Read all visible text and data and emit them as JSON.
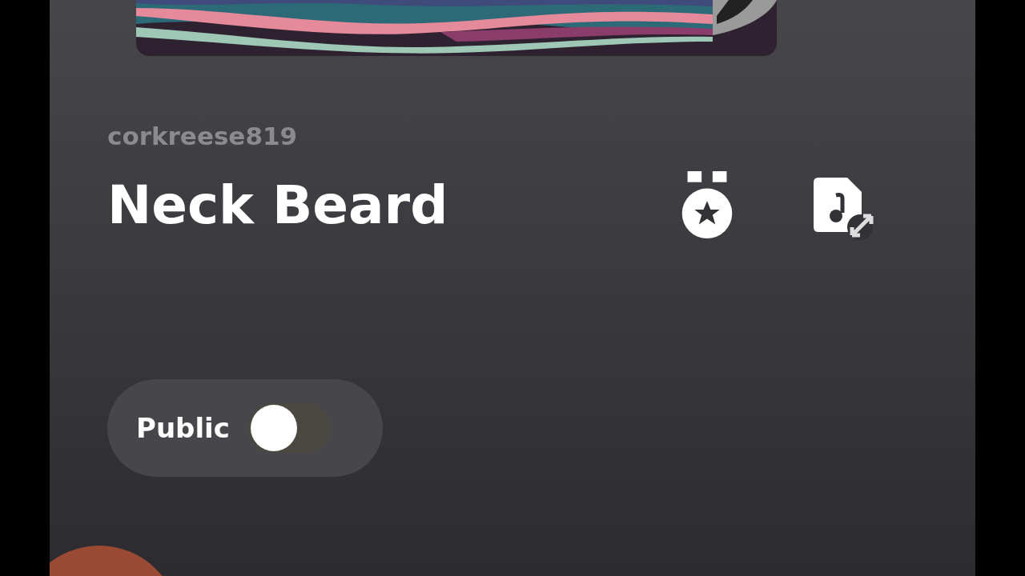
{
  "username": "corkreese819",
  "title": "Neck Beard",
  "visibility": {
    "label": "Public",
    "on": false
  }
}
